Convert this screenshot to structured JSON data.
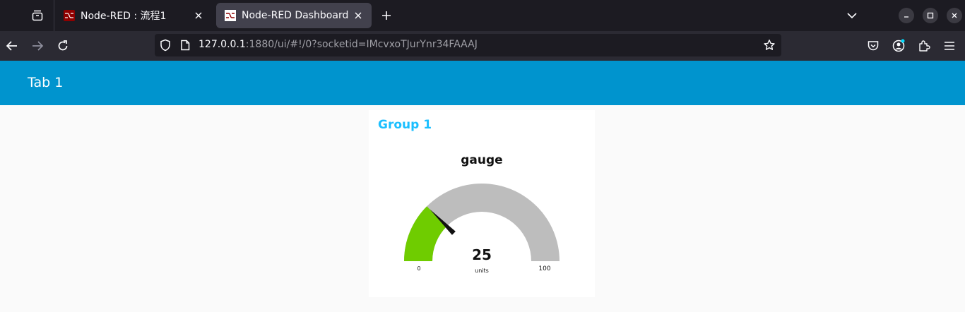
{
  "browser": {
    "tabs": [
      {
        "title": "Node-RED : 流程1",
        "active": false
      },
      {
        "title": "Node-RED Dashboard",
        "active": true
      }
    ],
    "url_host": "127.0.0.1",
    "url_rest": ":1880/ui/#!/0?socketid=IMcvxoTJurYnr34FAAAJ"
  },
  "dashboard": {
    "tab_title": "Tab 1",
    "group_title": "Group 1",
    "colors": {
      "header": "#0094ce",
      "group_title": "#1bbfff"
    }
  },
  "gauge": {
    "title": "gauge",
    "value": 25,
    "value_text": "25",
    "units": "units",
    "min": 0,
    "max": 100,
    "min_label": "0",
    "max_label": "100",
    "fill_color": "#6fcc00",
    "track_color": "#bdbdbd",
    "needle_color": "#111111"
  }
}
